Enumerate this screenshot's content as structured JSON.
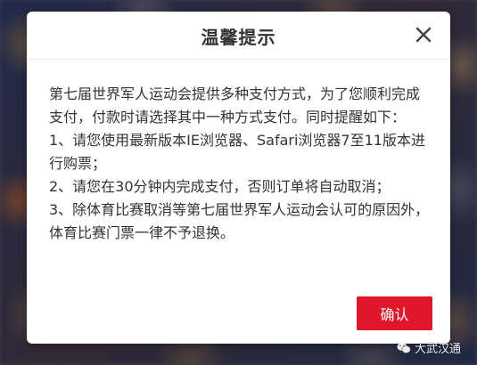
{
  "dialog": {
    "title": "温馨提示",
    "close_icon": "close-icon",
    "paragraphs": [
      "第七届世界军人运动会提供多种支付方式，为了您顺利完成支付，付款时请选择其中一种方式支付。同时提醒如下：",
      "1、请您使用最新版本IE浏览器、Safari浏览器7至11版本进行购票；",
      "2、请您在30分钟内完成支付，否则订单将自动取消；",
      "3、除体育比赛取消等第七届世界军人运动会认可的原因外，体育比赛门票一律不予退换。"
    ],
    "confirm_label": "确认"
  },
  "watermark": {
    "icon": "wechat-icon",
    "text": "大武汉通"
  },
  "colors": {
    "accent": "#e0162b",
    "text": "#333333",
    "divider": "#e8e8e8"
  }
}
